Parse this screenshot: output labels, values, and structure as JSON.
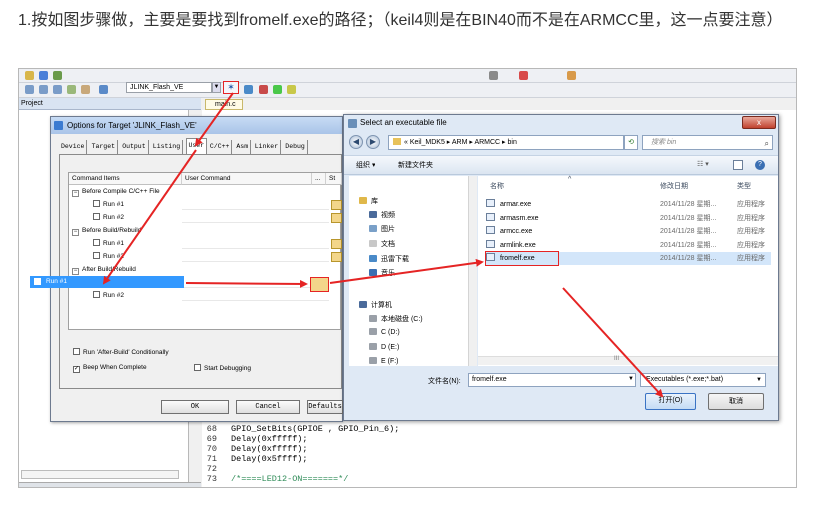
{
  "caption": "1.按如图步骤做，主要是要找到fromelf.exe的路径；（keil4则是在BIN40而不是在ARMCC里，这一点要注意）",
  "ide": {
    "target_name": "JLINK_Flash_VE",
    "project_label": "Project",
    "editor_tab": "main.c",
    "code_lines": [
      {
        "num": "68",
        "text": "GPIO_SetBits(GPIOE , GPIO_Pin_6);"
      },
      {
        "num": "69",
        "text": "Delay(0xfffff);"
      },
      {
        "num": "70",
        "text": "Delay(0xfffff);"
      },
      {
        "num": "71",
        "text": "Delay(0x5ffff);"
      },
      {
        "num": "72",
        "text": ""
      },
      {
        "num": "73",
        "text": "/*====LED12-ON=======*/"
      }
    ]
  },
  "options_dialog": {
    "title": "Options for Target 'JLINK_Flash_VE'",
    "tabs": [
      "Device",
      "Target",
      "Output",
      "Listing",
      "User",
      "C/C++",
      "Asm",
      "Linker",
      "Debug"
    ],
    "selected_tab": "User",
    "col_items": "Command Items",
    "col_command": "User Command",
    "col_dots": "...",
    "col_st": "St",
    "groups": [
      {
        "label": "Before Compile C/C++ File",
        "runs": [
          "Run #1",
          "Run #2"
        ]
      },
      {
        "label": "Before Build/Rebuild",
        "runs": [
          "Run #1",
          "Run #2"
        ]
      },
      {
        "label": "After Build/Rebuild",
        "runs": [
          "Run #1",
          "Run #2"
        ]
      }
    ],
    "nb_label": "No",
    "cond_label": "Run 'After-Build' Conditionally",
    "beep_label": "Beep When Complete",
    "startdbg_label": "Start Debugging",
    "ok_label": "OK",
    "cancel_label": "Cancel",
    "defaults_label": "Defaults"
  },
  "file_dialog": {
    "title": "Select an executable file",
    "close_glyph": "x",
    "breadcrumb": "« Keil_MDK5 ▸ ARM ▸ ARMCC ▸ bin",
    "search_placeholder": "搜索 bin",
    "toolbar_org": "组织 ▾",
    "toolbar_newfolder": "新建文件夹",
    "nav_items": [
      "库",
      "视频",
      "图片",
      "文档",
      "迅雷下载",
      "音乐",
      "计算机",
      "本地磁盘 (C:)",
      "C (D:)",
      "D (E:)",
      "E (F:)"
    ],
    "col_name": "名称",
    "col_date": "修改日期",
    "col_type": "类型",
    "files": [
      {
        "name": "armar.exe",
        "date": "2014/11/28 星期...",
        "type": "应用程序"
      },
      {
        "name": "armasm.exe",
        "date": "2014/11/28 星期...",
        "type": "应用程序"
      },
      {
        "name": "armcc.exe",
        "date": "2014/11/28 星期...",
        "type": "应用程序"
      },
      {
        "name": "armlink.exe",
        "date": "2014/11/28 星期...",
        "type": "应用程序"
      },
      {
        "name": "fromelf.exe",
        "date": "2014/11/28 星期...",
        "type": "应用程序"
      }
    ],
    "filename_label": "文件名(N):",
    "filename_value": "fromelf.exe",
    "filetype_value": "Executables (*.exe;*.bat)",
    "open_label": "打开(O)",
    "cancel_label": "取消",
    "scroll_mid": "III"
  },
  "colors": {
    "arrow": "#e52424",
    "selection": "#3399ff"
  }
}
